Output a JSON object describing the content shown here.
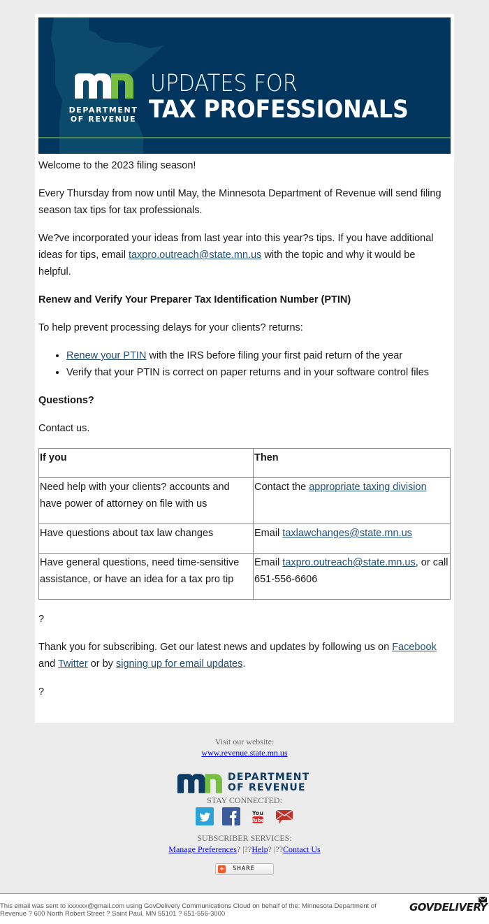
{
  "banner": {
    "logo_dept_line1": "DEPARTMENT",
    "logo_dept_line2": "OF REVENUE",
    "title_line1": "UPDATES FOR",
    "title_line2": "TAX PROFESSIONALS",
    "colors": {
      "background": "#02365f",
      "state_shape": "#0b4a6a",
      "accent_green": "#78be43",
      "rule": "#4f8a4f"
    }
  },
  "body": {
    "welcome": "Welcome to the 2023 filing season!",
    "intro": "Every Thursday from now until May, the Minnesota Department of Revenue will send filing season tax tips for tax professionals.",
    "ideas": {
      "before": "We?ve incorporated your ideas from last year into this year?s tips. If you have additional ideas for tips, email ",
      "link": "taxpro.outreach@state.mn.us",
      "after": " with the topic and why it would be helpful."
    },
    "ptin_heading": "Renew and Verify Your Preparer Tax Identification Number (PTIN)",
    "ptin_intro": "To help prevent processing delays for your clients? returns:",
    "bullets": [
      {
        "link": "Renew your PTIN",
        "text": " with the IRS before filing your first paid return of the year"
      },
      {
        "link": "",
        "text": "Verify that your PTIN is correct on paper returns and in your software control files"
      }
    ],
    "questions_heading": "Questions?",
    "contact_us": "Contact us.",
    "table": {
      "headers": [
        "If you",
        "Then"
      ],
      "rows": [
        {
          "if": "Need help with your clients? accounts and have power of attorney on file with us",
          "then_before": "Contact the ",
          "then_link": "appropriate taxing division",
          "then_after": ""
        },
        {
          "if": "Have questions about tax law changes",
          "then_before": "Email ",
          "then_link": "taxlawchanges@state.mn.us",
          "then_after": ""
        },
        {
          "if": "Have general questions, need time-sensitive assistance, or have an idea for a tax pro tip",
          "then_before": "Email ",
          "then_link": "taxpro.outreach@state.mn.us",
          "then_after": ", or call 651-556-6606"
        }
      ]
    },
    "placeholder_char": "?",
    "thanks": {
      "before": "Thank you for subscribing. Get our latest news and updates by following us on ",
      "facebook": "Facebook",
      "middle1": " and ",
      "twitter": "Twitter",
      "middle2": " or by ",
      "signup": "signing up for email updates",
      "after": "."
    },
    "link_color": "#1f4e79"
  },
  "footer": {
    "visit_label": "Visit our website:",
    "website": "www.revenue.state.mn.us",
    "logo_line1": "DEPARTMENT",
    "logo_line2": "OF REVENUE",
    "stay_connected": "STAY CONNECTED:",
    "social": [
      "twitter-icon",
      "facebook-icon",
      "youtube-icon",
      "email-icon"
    ],
    "subscriber_services": "SUBSCRIBER SERVICES:",
    "manage_preferences": "Manage Preferences",
    "sep1": "? |??",
    "help": "Help",
    "sep2": "? |??",
    "contact_us": "Contact Us",
    "share": "SHARE"
  },
  "bottom": {
    "disclaimer": "This email was sent to xxxxxx@gmail.com using GovDelivery Communications Cloud on behalf of the: Minnesota Department of Revenue ? 600 North Robert Street ? Saint Paul, MN 55101 ? 651-556-3000",
    "brand": "GOVDELIVERY"
  }
}
